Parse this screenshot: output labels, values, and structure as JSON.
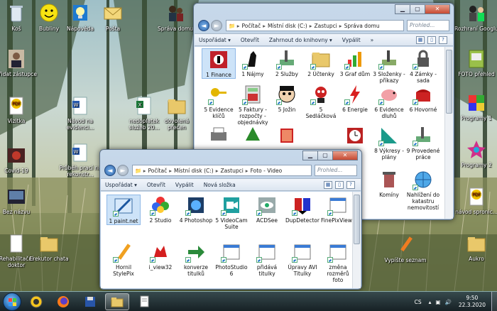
{
  "desktop": {
    "icons": [
      {
        "label": "Koš"
      },
      {
        "label": "Bubliny"
      },
      {
        "label": "Nápověda"
      },
      {
        "label": "Pošta"
      },
      {
        "label": "Správa domu"
      },
      {
        "label": "Přidat zástupce"
      },
      {
        "label": "Vizitka"
      },
      {
        "label": "Návod na evidenci..."
      },
      {
        "label": "nedoplatek služeb 20..."
      },
      {
        "label": "dovolená přečen"
      },
      {
        "label": "Covid-19"
      },
      {
        "label": "Průběh prací na rekonstr..."
      },
      {
        "label": "Bez názvu"
      },
      {
        "label": "Rehabilitační doktor"
      },
      {
        "label": "Erekutor chata"
      },
      {
        "label": "Vypíšte seznam"
      },
      {
        "label": "Rozhraní Googlu"
      },
      {
        "label": "FOTO přehled"
      },
      {
        "label": "Programy 1"
      },
      {
        "label": "Programy 2"
      },
      {
        "label": "návod spronic..."
      },
      {
        "label": "Aukro"
      }
    ]
  },
  "window_back": {
    "path": [
      "Počítač",
      "Místní disk (C:)",
      "Zastupci",
      "Správa domu"
    ],
    "search_placeholder": "Prohled...",
    "toolbar": [
      "Uspořádat ▾",
      "Otevřít",
      "Zahrnout do knihovny ▾",
      "Vypálit",
      "»"
    ],
    "items": [
      {
        "label": "1 Finance"
      },
      {
        "label": "1 Nájmy"
      },
      {
        "label": "2 Služby"
      },
      {
        "label": "2 Účtenky"
      },
      {
        "label": "3 Graf dům"
      },
      {
        "label": "3 Složenky - příkazy"
      },
      {
        "label": "4 Zámky - sada"
      },
      {
        "label": "5 Evidence klíčů"
      },
      {
        "label": "5 Faktury - rozpočty - objednávky"
      },
      {
        "label": "5 Jožin"
      },
      {
        "label": "5 Sedláčková"
      },
      {
        "label": "6 Energie"
      },
      {
        "label": "6 Evidence dluhů"
      },
      {
        "label": "6 Hovorné"
      },
      {
        "label": "8 Výkresy - plány"
      },
      {
        "label": "9 Provedené práce"
      },
      {
        "label": "Komíny"
      },
      {
        "label": "Nahlížení do katastru nemovitostí"
      }
    ]
  },
  "window_front": {
    "path": [
      "Počítač",
      "Místní disk (C:)",
      "Zastupci",
      "Foto - Video"
    ],
    "search_placeholder": "Prohled...",
    "toolbar": [
      "Uspořádat ▾",
      "Otevřít",
      "Vypálit",
      "Nová složka"
    ],
    "items": [
      {
        "label": "1 paint.net"
      },
      {
        "label": "2 Studio"
      },
      {
        "label": "4 Photoshop"
      },
      {
        "label": "5 VideoCam Suite"
      },
      {
        "label": "ACDSee"
      },
      {
        "label": "DupDetector"
      },
      {
        "label": "FinePixViewer"
      },
      {
        "label": "Hornil StylePix"
      },
      {
        "label": "i_view32"
      },
      {
        "label": "konverze titulků"
      },
      {
        "label": "PhotoStudio 6"
      },
      {
        "label": "přidává titulky"
      },
      {
        "label": "Úpravy AVI Titulky"
      },
      {
        "label": "změna rozměrů foto"
      }
    ]
  },
  "taskbar": {
    "lang": "CS",
    "time": "9:50",
    "date": "22.3.2020"
  },
  "colors": {
    "accent": "#1c5fa8",
    "selection": "#cde3f8"
  }
}
